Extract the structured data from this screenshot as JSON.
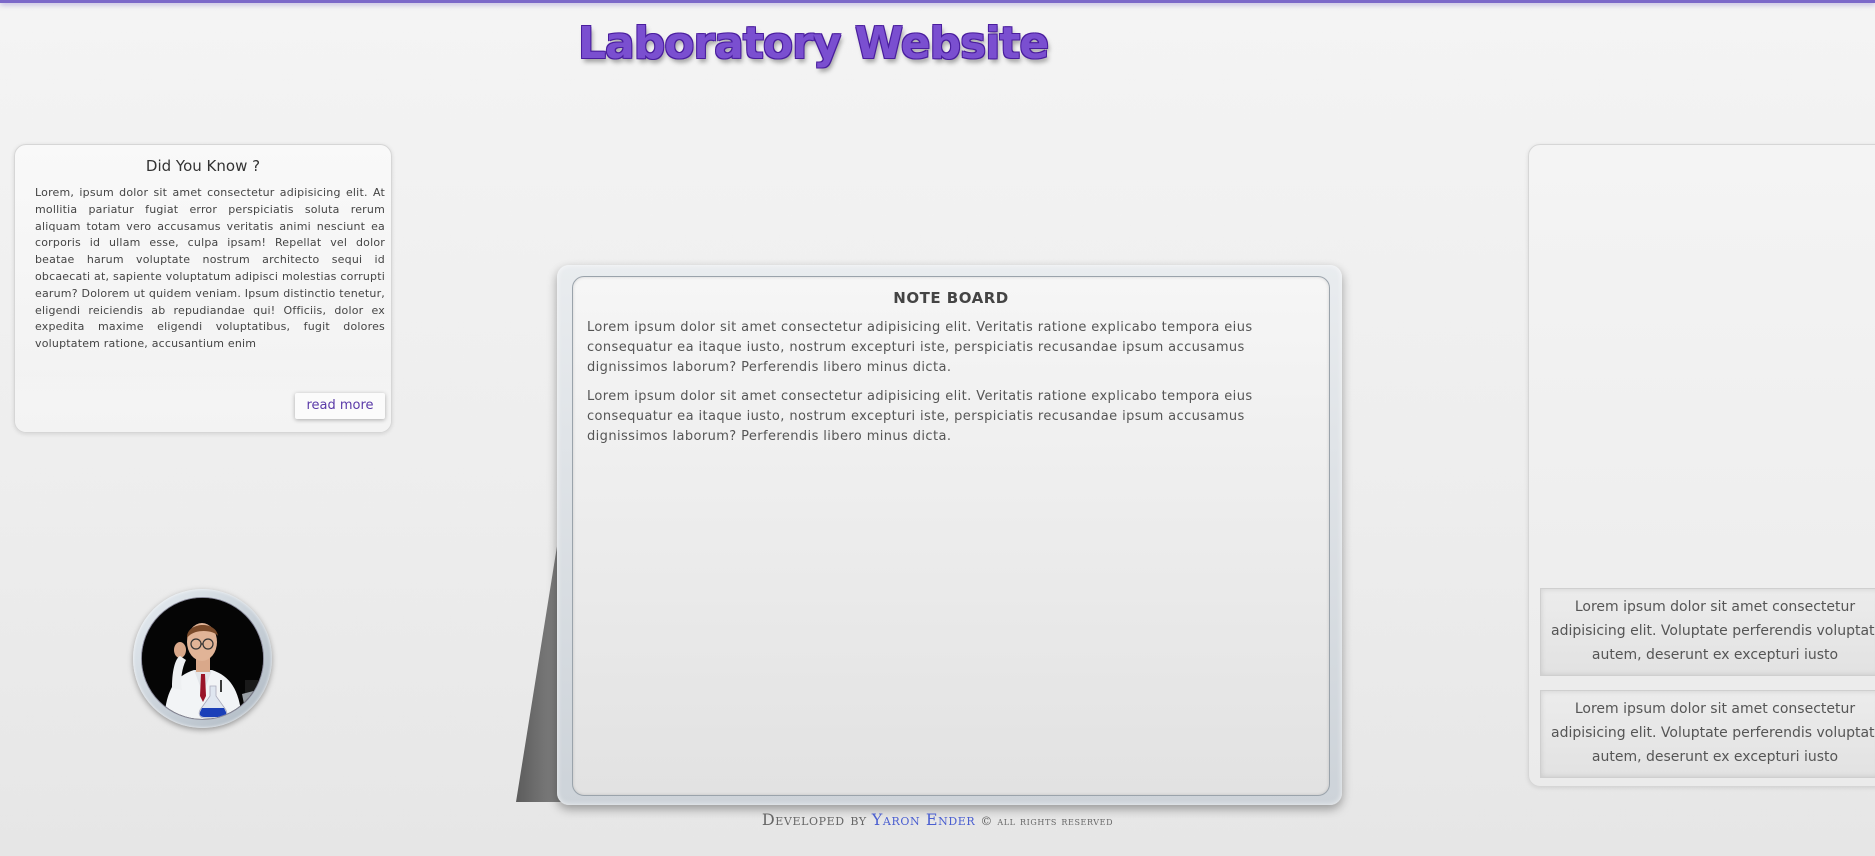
{
  "header": {
    "title": "Laboratory Website"
  },
  "did_you_know": {
    "title": "Did You Know ?",
    "text": "Lorem, ipsum dolor sit amet consectetur adipisicing elit. At mollitia pariatur fugiat error perspiciatis soluta rerum aliquam totam vero accusamus veritatis animi nesciunt ea corporis id ullam esse, culpa ipsam! Repellat vel dolor beatae harum voluptate nostrum architecto sequi id obcaecati at, sapiente voluptatum adipisci molestias corrupti earum? Dolorem ut quidem veniam. Ipsum distinctio tenetur, eligendi reiciendis ab repudiandae qui! Officiis, dolor ex expedita maxime eligendi voluptatibus, fugit dolores voluptatem ratione, accusantium enim",
    "read_more_label": "read more"
  },
  "note_board": {
    "title": "NOTE BOARD",
    "paragraphs": [
      "Lorem ipsum dolor sit amet consectetur adipisicing elit. Veritatis ratione explicabo tempora eius consequatur ea itaque iusto, nostrum excepturi iste, perspiciatis recusandae ipsum accusamus dignissimos laborum? Perferendis libero minus dicta.",
      "Lorem ipsum dolor sit amet consectetur adipisicing elit. Veritatis ratione explicabo tempora eius consequatur ea itaque iusto, nostrum excepturi iste, perspiciatis recusandae ipsum accusamus dignissimos laborum? Perferendis libero minus dicta."
    ]
  },
  "right_notes": [
    {
      "lines": [
        "Lorem ipsum dolor sit amet consectetur",
        "adipisicing elit. Voluptate perferendis voluptatum",
        "autem, deserunt ex excepturi iusto"
      ]
    },
    {
      "lines": [
        "Lorem ipsum dolor sit amet consectetur",
        "adipisicing elit. Voluptate perferendis voluptatum",
        "autem, deserunt ex excepturi iusto"
      ]
    }
  ],
  "footer": {
    "developed_by": "Developed by",
    "author": "Yaron Ender",
    "rights": "© all rights reserved"
  },
  "colors": {
    "accent": "#7a4fd0",
    "link": "#4b5fd0",
    "top_bar": "#7b68c9"
  }
}
